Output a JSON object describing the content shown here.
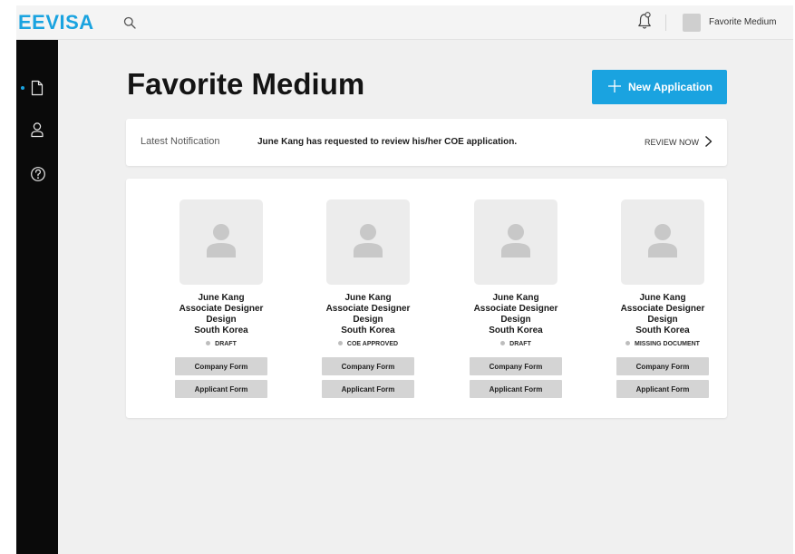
{
  "header": {
    "logo": "EEVISA",
    "user_name": "Favorite Medium",
    "icons": [
      "search-icon",
      "bell-icon"
    ]
  },
  "sidebar": {
    "items": [
      {
        "icon": "document-icon",
        "active": true
      },
      {
        "icon": "user-icon",
        "active": false
      },
      {
        "icon": "help-icon",
        "active": false
      }
    ]
  },
  "page": {
    "title": "Favorite Medium",
    "new_application_label": "New Application"
  },
  "notification": {
    "label": "Latest Notification",
    "message": "June Kang has requested to review his/her COE application.",
    "action_label": "REVIEW NOW"
  },
  "applications": [
    {
      "name": "June Kang",
      "title": "Associate Designer",
      "department": "Design",
      "country": "South Korea",
      "status": "DRAFT",
      "company_form_label": "Company Form",
      "applicant_form_label": "Applicant Form"
    },
    {
      "name": "June Kang",
      "title": "Associate Designer",
      "department": "Design",
      "country": "South Korea",
      "status": "COE APPROVED",
      "company_form_label": "Company Form",
      "applicant_form_label": "Applicant Form"
    },
    {
      "name": "June Kang",
      "title": "Associate Designer",
      "department": "Design",
      "country": "South Korea",
      "status": "DRAFT",
      "company_form_label": "Company Form",
      "applicant_form_label": "Applicant Form"
    },
    {
      "name": "June Kang",
      "title": "Associate Designer",
      "department": "Design",
      "country": "South Korea",
      "status": "MISSING DOCUMENT",
      "company_form_label": "Company Form",
      "applicant_form_label": "Applicant Form"
    }
  ],
  "colors": {
    "accent": "#1aa3e0",
    "sidebar": "#0a0a0a",
    "background": "#f0f0f0",
    "button_gray": "#d4d4d4"
  }
}
